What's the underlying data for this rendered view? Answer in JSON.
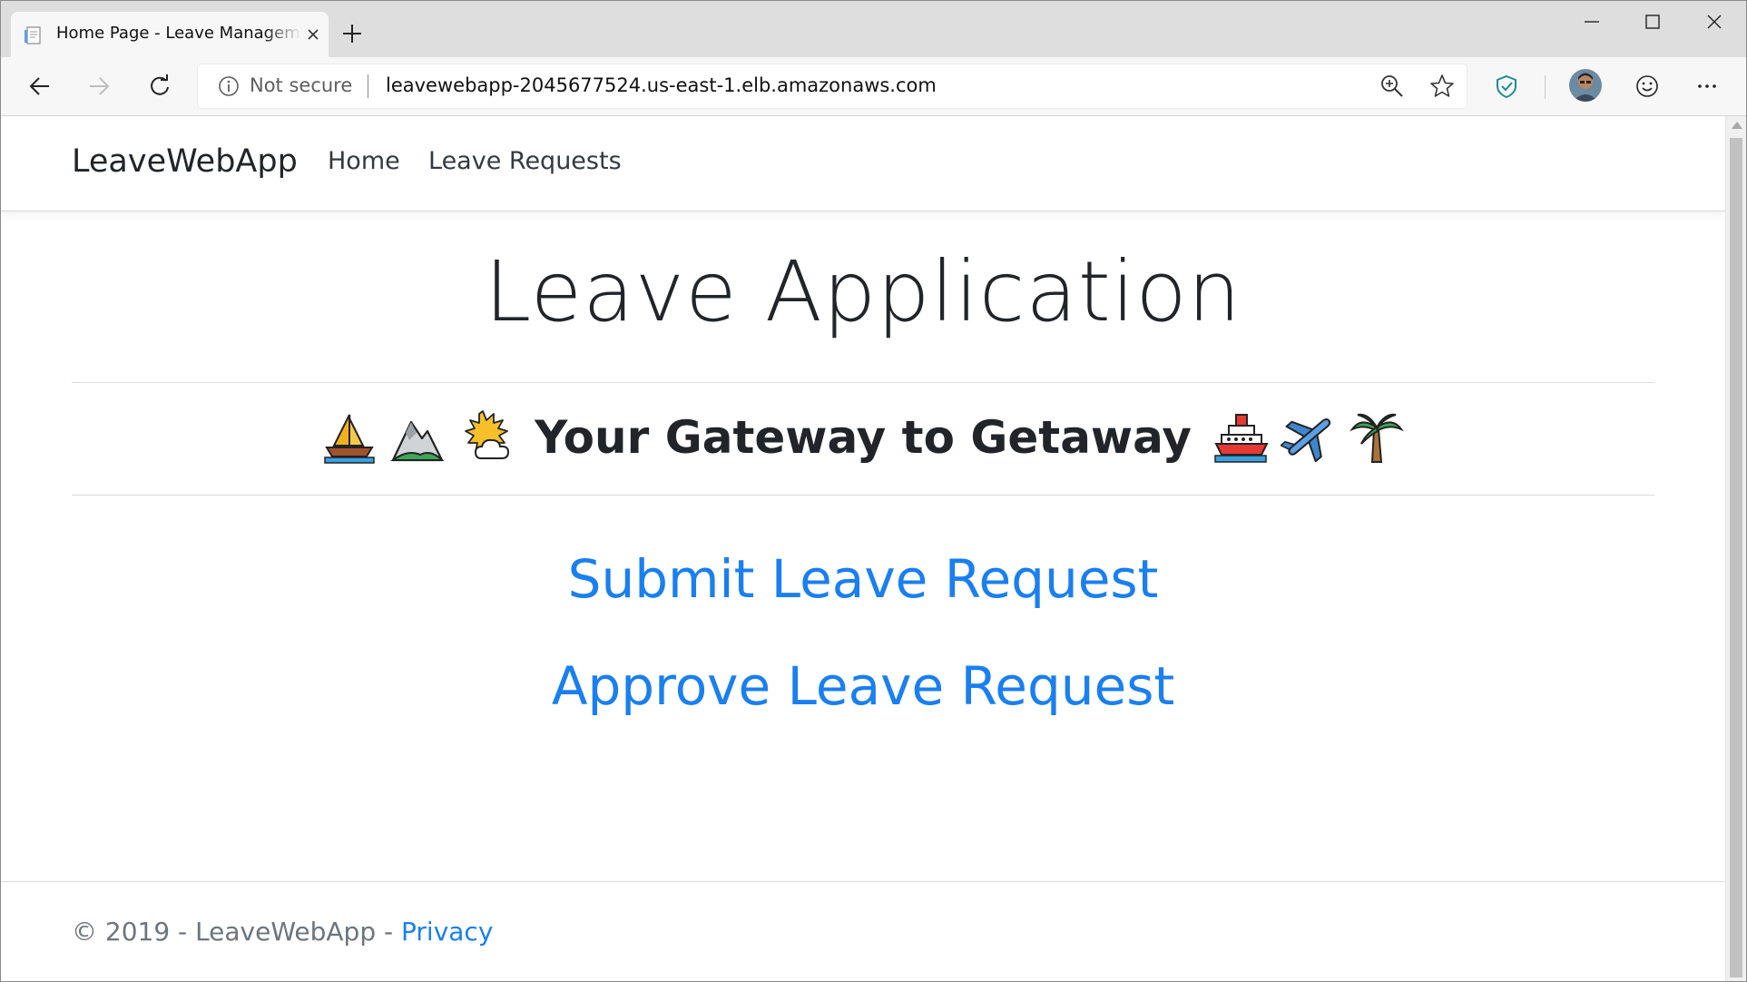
{
  "browser": {
    "tab": {
      "title": "Home Page - Leave Management",
      "favicon": "page-icon"
    },
    "new_tab_icon": "plus-icon",
    "window_controls": [
      "minimize-icon",
      "maximize-icon",
      "close-icon"
    ],
    "toolbar": {
      "back_icon": "arrow-left-icon",
      "forward_icon": "arrow-right-icon",
      "refresh_icon": "refresh-icon",
      "security_icon": "info-icon",
      "security_text": "Not secure",
      "url": "leavewebapp-2045677524.us-east-1.elb.amazonaws.com",
      "zoom_icon": "zoom-icon",
      "favorite_icon": "star-icon",
      "extension_icon": "shield-icon",
      "profile_icon": "avatar",
      "feedback_icon": "smiley-icon",
      "menu_icon": "more-icon"
    }
  },
  "site": {
    "brand": "LeaveWebApp",
    "nav": [
      {
        "label": "Home"
      },
      {
        "label": "Leave Requests"
      }
    ]
  },
  "main": {
    "title": "Leave Application",
    "tagline": "Your Gateway to Getaway",
    "tagline_emojis_before": [
      "sailboat-icon",
      "mountain-icon",
      "sun-behind-cloud-icon"
    ],
    "tagline_emojis_after": [
      "ship-icon",
      "airplane-icon",
      "palm-tree-icon"
    ],
    "actions": [
      {
        "label": "Submit Leave Request"
      },
      {
        "label": "Approve Leave Request"
      }
    ]
  },
  "footer": {
    "text": "© 2019 - LeaveWebApp - ",
    "link": "Privacy"
  },
  "colors": {
    "link": "#1a7ff0",
    "text": "#212529",
    "muted": "#6c757d",
    "chrome": "#dedede"
  }
}
